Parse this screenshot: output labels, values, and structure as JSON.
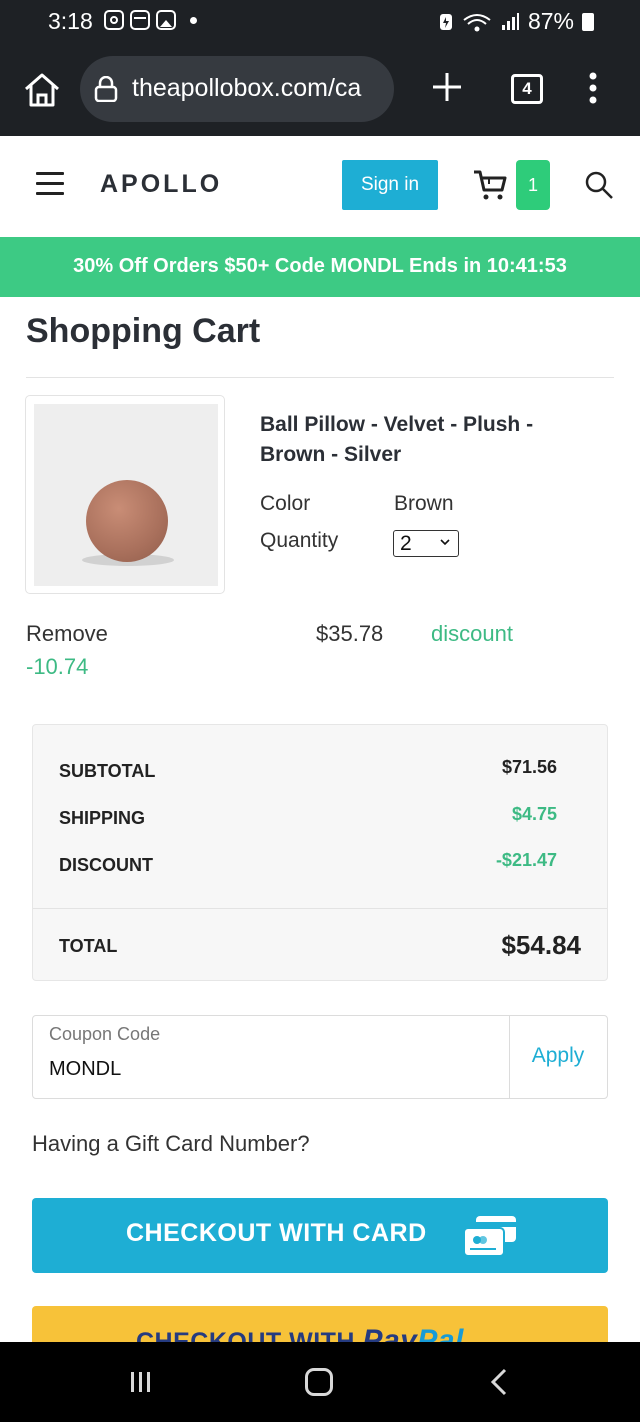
{
  "status_bar": {
    "time": "3:18",
    "battery": "87%"
  },
  "browser": {
    "url": "theapollobox.com/ca",
    "tab_count": "4"
  },
  "header": {
    "logo": "APOLLO",
    "sign_in_label": "Sign in",
    "cart_count": "1"
  },
  "promo": {
    "text": "30% Off Orders $50+ Code MONDL Ends in 10:41:53"
  },
  "page": {
    "title": "Shopping Cart"
  },
  "cart_item": {
    "name": "Ball Pillow - Velvet - Plush - Brown - Silver",
    "color_label": "Color",
    "color_value": "Brown",
    "quantity_label": "Quantity",
    "quantity_value": "2",
    "remove_label": "Remove",
    "discount_amount": "-10.74",
    "price": "$35.78",
    "discount_label": "discount",
    "image_colors": {
      "pillow": "#a9705c",
      "background": "#eeeeee"
    }
  },
  "summary": {
    "subtotal_label": "SUBTOTAL",
    "subtotal_value": "$71.56",
    "shipping_label": "SHIPPING",
    "shipping_value": "$4.75",
    "discount_label": "DISCOUNT",
    "discount_value": "-$21.47",
    "total_label": "TOTAL",
    "total_value": "$54.84"
  },
  "coupon": {
    "label": "Coupon Code",
    "value": "MONDL",
    "apply_label": "Apply"
  },
  "gift_card": {
    "link_text": "Having a Gift Card Number?"
  },
  "checkout": {
    "card_label": "CHECKOUT WITH CARD",
    "paypal_label": "CHECKOUT WITH",
    "paypal_brand_1": "Pay",
    "paypal_brand_2": "Pal"
  },
  "colors": {
    "accent_blue": "#1eaed4",
    "accent_green": "#3dca84",
    "paypal_yellow": "#f7c239"
  }
}
